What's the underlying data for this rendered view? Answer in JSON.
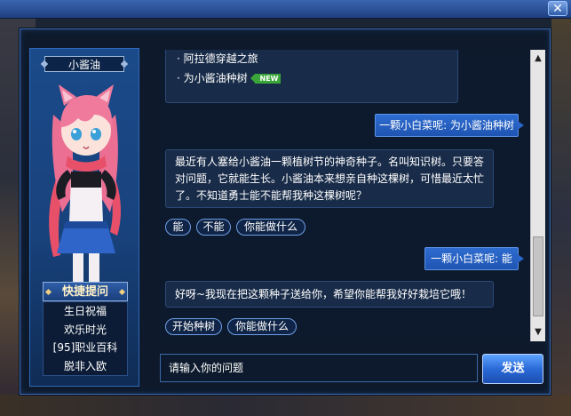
{
  "window": {
    "close_label": "✕"
  },
  "character": {
    "name": "小酱油"
  },
  "quick_questions": {
    "header": "快捷提问",
    "items": [
      "生日祝福",
      "欢乐时光",
      "[95]职业百科",
      "脱非入欧"
    ]
  },
  "chat": {
    "menu_items": [
      "阿拉德穿越之旅",
      "为小酱油种树"
    ],
    "menu_bullet": "·",
    "new_badge": "NEW",
    "user_message_1": "一颗小白菜呢: 为小酱油种树",
    "npc_message_1": "最近有人塞给小酱油一颗植树节的神奇种子。名叫知识树。只要答对问题，它就能生长。小酱油本来想亲自种这棵树，可惜最近太忙了。不知道勇士能不能帮我种这棵树呢？",
    "options_1": [
      "能",
      "不能",
      "你能做什么"
    ],
    "user_message_2": "一颗小白菜呢: 能",
    "npc_message_2": "好呀~我现在把这颗种子送给你，希望你能帮我好好栽培它哦！",
    "options_2": [
      "开始种树",
      "你能做什么"
    ]
  },
  "input": {
    "placeholder": "请输入你的问题"
  },
  "send_button": "发送",
  "colors": {
    "accent": "#2a6ad8",
    "panel": "#18427c",
    "new_badge": "#3aa63a"
  }
}
